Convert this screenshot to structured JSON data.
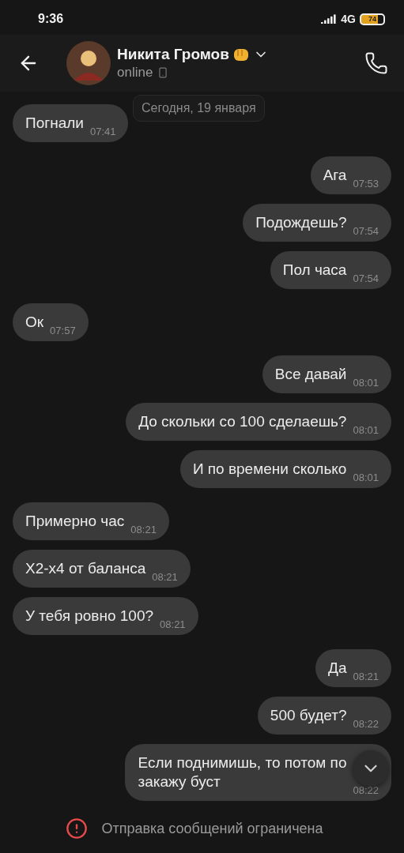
{
  "status_bar": {
    "time": "9:36",
    "network": "4G",
    "battery": "74"
  },
  "header": {
    "name": "Никита Громов",
    "status": "online"
  },
  "date_chip": "Сегодня, 19 января",
  "messages": [
    {
      "kind": "incoming",
      "text": "Погнали",
      "time": "07:41"
    },
    {
      "kind": "outgoing",
      "text": "Ага",
      "time": "07:53"
    },
    {
      "kind": "outgoing",
      "text": "Подождешь?",
      "time": "07:54"
    },
    {
      "kind": "outgoing",
      "text": "Пол часа",
      "time": "07:54"
    },
    {
      "kind": "incoming",
      "text": "Ок",
      "time": "07:57"
    },
    {
      "kind": "outgoing",
      "text": "Все давай",
      "time": "08:01"
    },
    {
      "kind": "outgoing",
      "text": "До скольки со 100 сделаешь?",
      "time": "08:01"
    },
    {
      "kind": "outgoing",
      "text": "И по времени сколько",
      "time": "08:01"
    },
    {
      "kind": "incoming",
      "text": "Примерно час",
      "time": "08:21"
    },
    {
      "kind": "incoming",
      "text": "X2-x4 от баланса",
      "time": "08:21"
    },
    {
      "kind": "incoming",
      "text": "У тебя ровно 100?",
      "time": "08:21"
    },
    {
      "kind": "outgoing",
      "text": "Да",
      "time": "08:21"
    },
    {
      "kind": "outgoing",
      "text": "500 будет?",
      "time": "08:22"
    },
    {
      "kind": "outgoing",
      "text": "Если поднимишь, то потом по\nзакажу буст",
      "time": "08:22"
    }
  ],
  "footer": {
    "notice": "Отправка сообщений ограничена"
  }
}
